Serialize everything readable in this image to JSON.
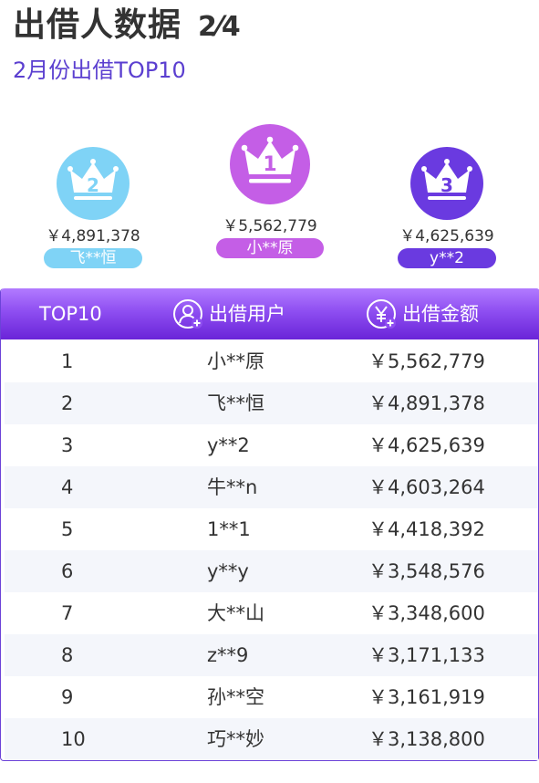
{
  "header": {
    "title": "出借人数据",
    "page": "2⁄4",
    "subtitle": "2月份出借TOP10"
  },
  "podium": {
    "first": {
      "rank": "1",
      "amount": "￥5,562,779",
      "name": "小**原",
      "color": "#c45ee6"
    },
    "second": {
      "rank": "2",
      "amount": "￥4,891,378",
      "name": "飞**恒",
      "color": "#7fd3f6"
    },
    "third": {
      "rank": "3",
      "amount": "￥4,625,639",
      "name": "y**2",
      "color": "#6a3ae0"
    }
  },
  "table": {
    "columns": {
      "rank": "TOP10",
      "user": "出借用户",
      "amount": "出借金额"
    },
    "icons": {
      "user": "user-add-icon",
      "amount": "yen-add-icon",
      "crown": "crown-icon"
    },
    "rows": [
      {
        "rank": "1",
        "user": "小**原",
        "amount": "￥5,562,779"
      },
      {
        "rank": "2",
        "user": "飞**恒",
        "amount": "￥4,891,378"
      },
      {
        "rank": "3",
        "user": "y**2",
        "amount": "￥4,625,639"
      },
      {
        "rank": "4",
        "user": "牛**n",
        "amount": "￥4,603,264"
      },
      {
        "rank": "5",
        "user": "1**1",
        "amount": "￥4,418,392"
      },
      {
        "rank": "6",
        "user": "y**y",
        "amount": "￥3,548,576"
      },
      {
        "rank": "7",
        "user": "大**山",
        "amount": "￥3,348,600"
      },
      {
        "rank": "8",
        "user": "z**9",
        "amount": "￥3,171,133"
      },
      {
        "rank": "9",
        "user": "孙**空",
        "amount": "￥3,161,919"
      },
      {
        "rank": "10",
        "user": "巧**妙",
        "amount": "￥3,138,800"
      }
    ]
  }
}
